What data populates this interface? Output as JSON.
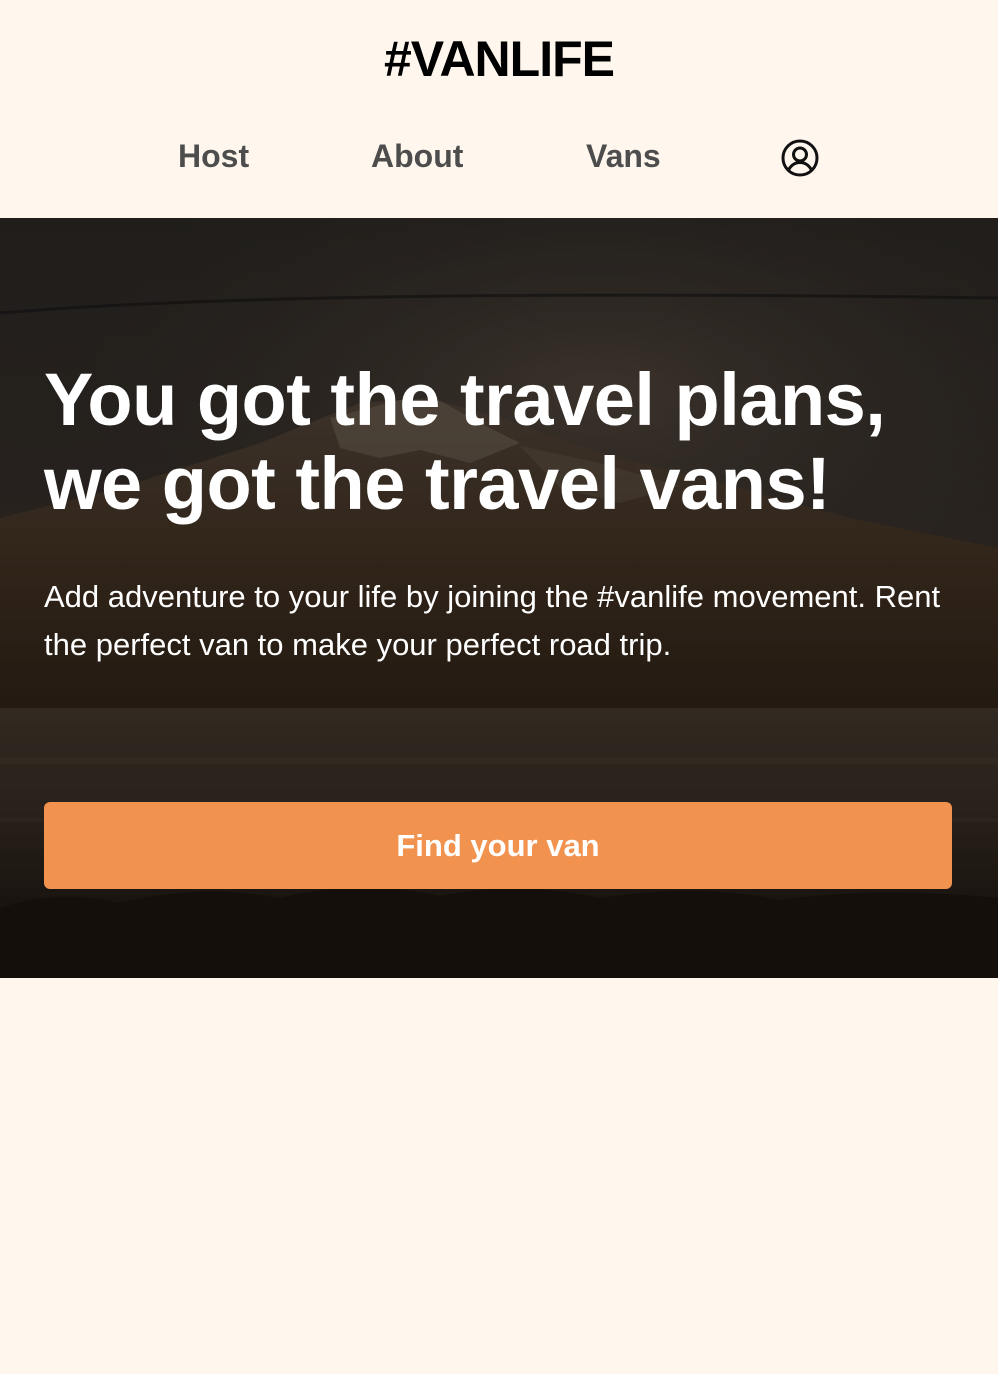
{
  "header": {
    "logo": "#VANLIFE",
    "nav": {
      "host_label": "Host",
      "about_label": "About",
      "vans_label": "Vans",
      "login_icon": "user-circle-icon"
    }
  },
  "hero": {
    "title_line1": "You got the travel plans,",
    "title_line2": "we got the travel vans!",
    "description": "Add adventure to your life by joining the #vanlife movement. Rent the perfect van to make your perfect road trip.",
    "cta_label": "Find your van"
  },
  "colors": {
    "background": "#FFF7ED",
    "nav_text": "#4D4D4D",
    "accent": "#F1924E",
    "logo": "#000000"
  }
}
